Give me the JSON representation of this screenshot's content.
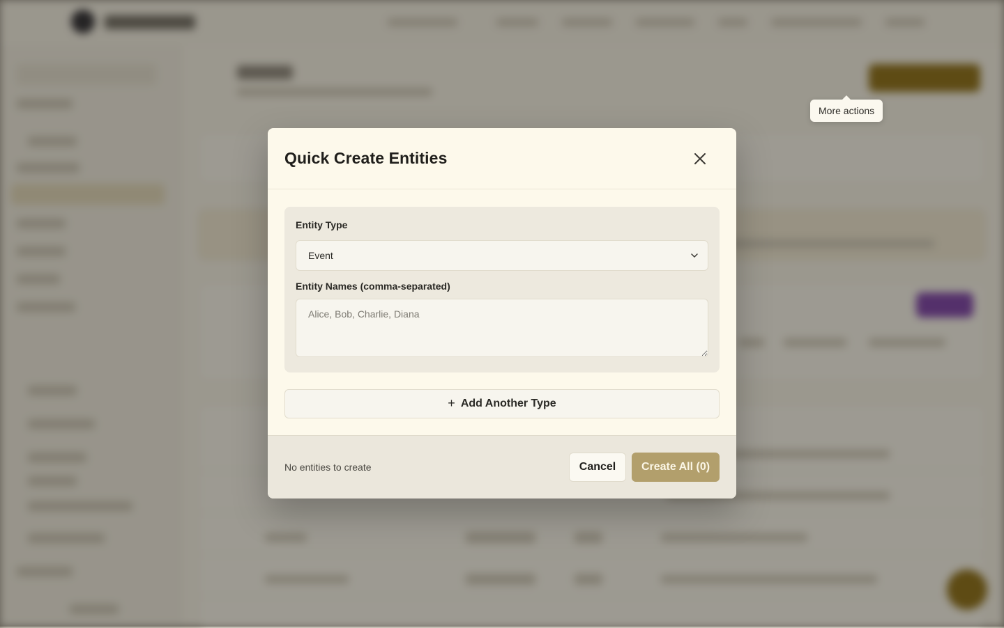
{
  "tooltip": {
    "text": "More actions"
  },
  "modal": {
    "title": "Quick Create Entities",
    "close_icon": "close-icon",
    "entity_type": {
      "label": "Entity Type",
      "selected": "Event"
    },
    "entity_names": {
      "label": "Entity Names (comma-separated)",
      "placeholder": "Alice, Bob, Charlie, Diana",
      "value": ""
    },
    "add_type_label": "Add Another Type",
    "footer": {
      "status": "No entities to create",
      "cancel_label": "Cancel",
      "create_label": "Create All (0)"
    }
  },
  "colors": {
    "accent_disabled": "#b29f6c",
    "modal_background": "#fdf9eb",
    "background_gold": "#8c6d12",
    "background_purple": "#7b3fa7"
  }
}
